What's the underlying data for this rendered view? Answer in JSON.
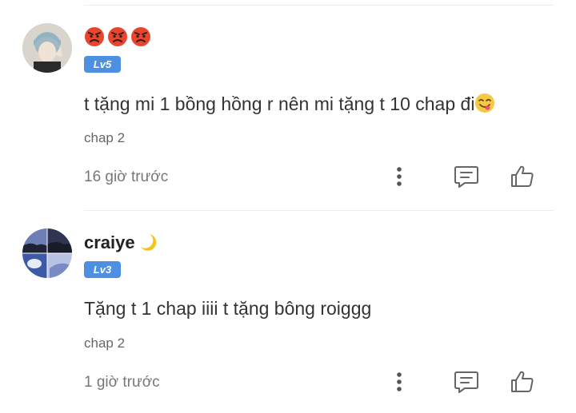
{
  "comments": [
    {
      "username_emoji": [
        "angry-face",
        "angry-face",
        "angry-face"
      ],
      "level": "Lv5",
      "text": "t tặng mi 1 bồng hồng r nên mi tặng t 10 chap đi",
      "text_emoji": "yum-face",
      "chapter": "chap 2",
      "time": "16 giờ trước"
    },
    {
      "username": "craiye",
      "username_emoji": "crescent-moon",
      "level": "Lv3",
      "text": "Tặng t 1 chap iiii t tặng bông roiggg",
      "chapter": "chap 2",
      "time": "1 giờ trước"
    }
  ],
  "colors": {
    "badge": "#4d8fe0",
    "icon": "#666666",
    "divider": "#ececec"
  }
}
